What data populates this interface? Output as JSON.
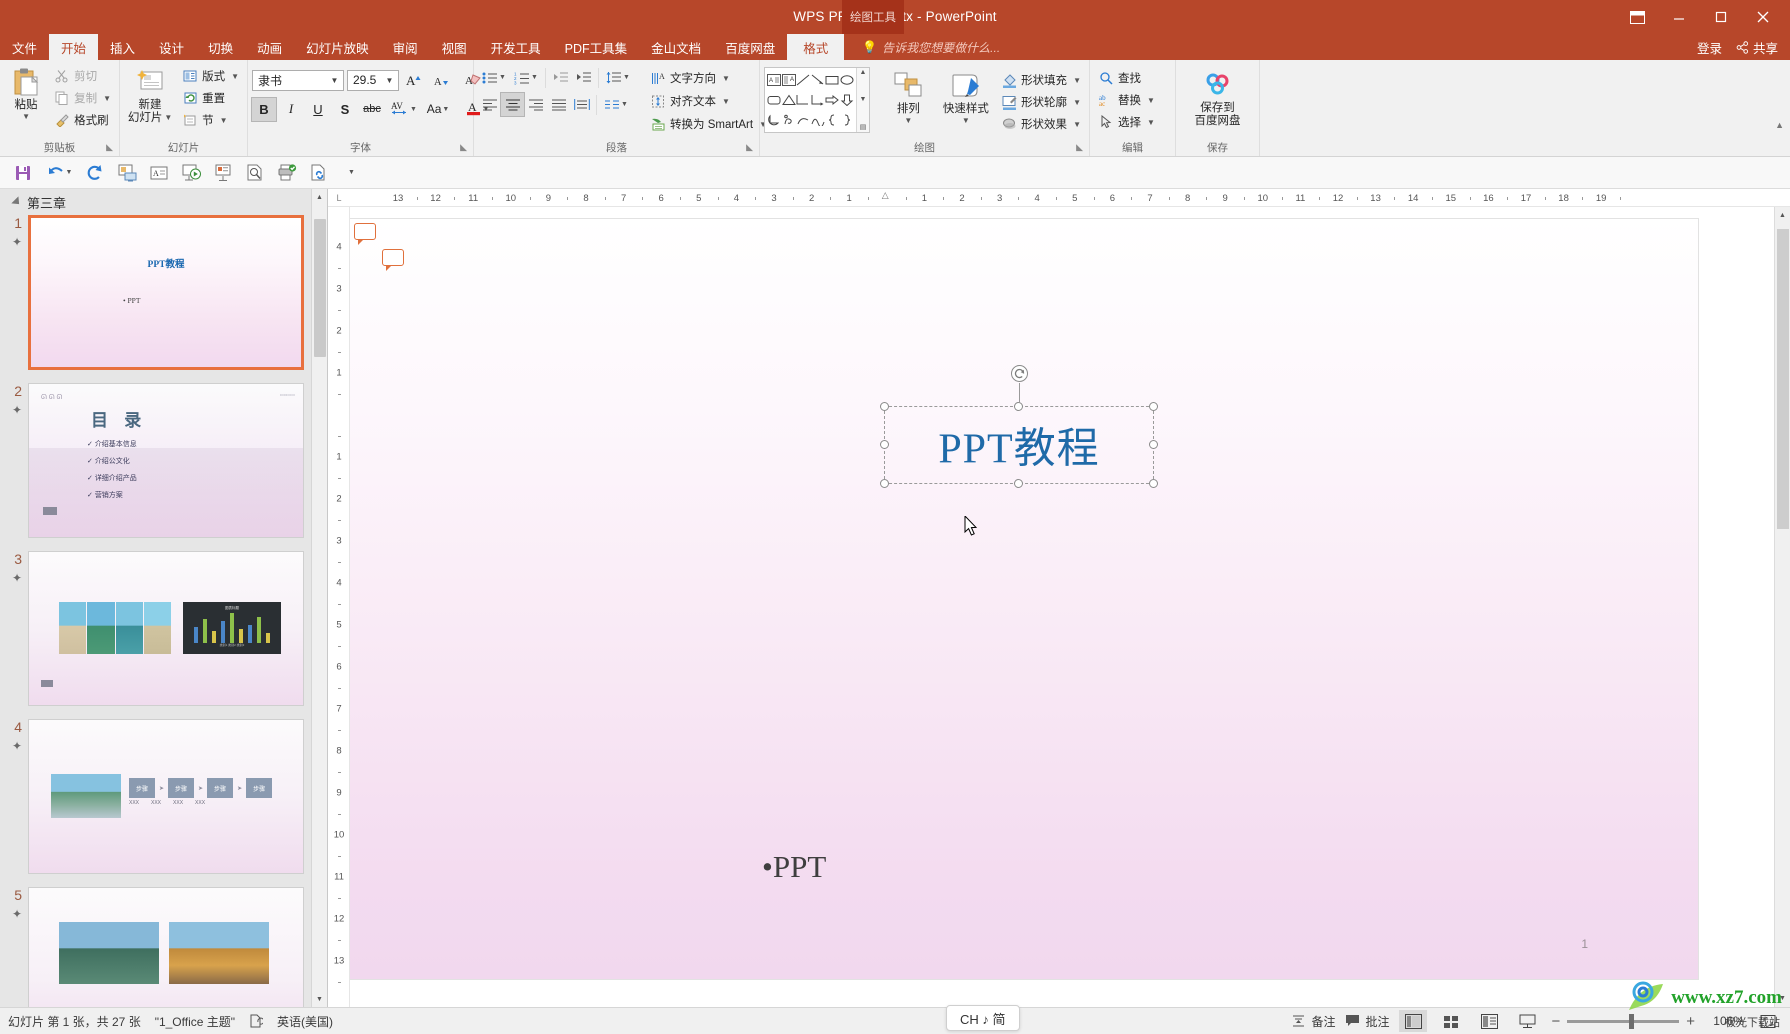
{
  "window": {
    "title": "WPS PPT教程.pptx - PowerPoint",
    "contextual_tool_label": "绘图工具",
    "restore_label": "▣",
    "minimize_label": "–",
    "maximize_label": "□",
    "close_label": "✕"
  },
  "tabs": [
    {
      "label": "文件",
      "active": false
    },
    {
      "label": "开始",
      "active": true
    },
    {
      "label": "插入",
      "active": false
    },
    {
      "label": "设计",
      "active": false
    },
    {
      "label": "切换",
      "active": false
    },
    {
      "label": "动画",
      "active": false
    },
    {
      "label": "幻灯片放映",
      "active": false
    },
    {
      "label": "审阅",
      "active": false
    },
    {
      "label": "视图",
      "active": false
    },
    {
      "label": "开发工具",
      "active": false
    },
    {
      "label": "PDF工具集",
      "active": false
    },
    {
      "label": "金山文档",
      "active": false
    },
    {
      "label": "百度网盘",
      "active": false
    }
  ],
  "contextual_tab": {
    "label": "格式"
  },
  "tellme": {
    "placeholder": "告诉我您想要做什么..."
  },
  "account": {
    "signin": "登录",
    "share": "共享"
  },
  "ribbon": {
    "clipboard": {
      "group_label": "剪贴板",
      "paste": "粘贴",
      "cut": "剪切",
      "copy": "复制",
      "format_painter": "格式刷"
    },
    "slides": {
      "group_label": "幻灯片",
      "new_slide_line1": "新建",
      "new_slide_line2": "幻灯片",
      "layout": "版式",
      "reset": "重置",
      "section": "节"
    },
    "font": {
      "group_label": "字体",
      "font_name": "隶书",
      "font_size": "29.5",
      "grow": "A",
      "shrink": "A",
      "clear_format": "清除所有格式",
      "bold": "B",
      "italic": "I",
      "underline": "U",
      "shadow": "S",
      "strikethrough": "abc",
      "char_spacing": "AV",
      "change_case": "Aa",
      "font_color": "A"
    },
    "paragraph": {
      "group_label": "段落",
      "bullets": "项目符号",
      "numbering": "编号",
      "decrease_indent": "减少缩进量",
      "increase_indent": "增加缩进量",
      "line_spacing": "行距",
      "align_left": "左对齐",
      "align_center": "居中",
      "align_right": "右对齐",
      "justify": "两端对齐",
      "distribute": "分散对齐",
      "columns": "分栏",
      "text_direction": "文字方向",
      "align_text": "对齐文本",
      "smartart": "转换为 SmartArt"
    },
    "drawing": {
      "group_label": "绘图",
      "arrange": "排列",
      "quick_styles": "快速样式",
      "shape_fill": "形状填充",
      "shape_outline": "形状轮廓",
      "shape_effects": "形状效果"
    },
    "editing": {
      "group_label": "编辑",
      "find": "查找",
      "replace": "替换",
      "select": "选择"
    },
    "save": {
      "group_label": "保存",
      "baidu_line1": "保存到",
      "baidu_line2": "百度网盘"
    }
  },
  "qat": {
    "save": "保存",
    "undo": "撤消",
    "redo": "恢复",
    "start_presentation": "从头开始",
    "text_box": "文本框",
    "present_online": "联机演示",
    "current_slide": "从当前幻灯片开始",
    "preview": "打印预览",
    "print": "快速打印",
    "hyperlink": "超链接"
  },
  "slide_panel": {
    "section_name": "第三章",
    "slides": [
      {
        "num": "1",
        "selected": true,
        "title": "PPT教程",
        "body": "PPT"
      },
      {
        "num": "2",
        "selected": false,
        "title": "目 录",
        "items": [
          "介绍基本信息",
          "介绍公文化",
          "详细介绍产品",
          "营销方案"
        ]
      },
      {
        "num": "3",
        "selected": false,
        "title": ""
      },
      {
        "num": "4",
        "selected": false,
        "title": "",
        "steps": [
          "步骤",
          "步骤",
          "步骤",
          "步骤"
        ],
        "captions": [
          "XXX",
          "XXX",
          "XXX",
          "XXX"
        ]
      },
      {
        "num": "5",
        "selected": false,
        "title": ""
      }
    ]
  },
  "ruler": {
    "h_ticks": [
      "13",
      "12",
      "11",
      "10",
      "9",
      "8",
      "7",
      "6",
      "5",
      "4",
      "3",
      "2",
      "1",
      "",
      "1",
      "2",
      "3",
      "4",
      "5",
      "6",
      "7",
      "8",
      "9",
      "10",
      "11",
      "12",
      "13",
      "14",
      "15",
      "16",
      "17",
      "18",
      "19"
    ],
    "v_ticks": [
      "4",
      "3",
      "2",
      "1",
      "",
      "1",
      "2",
      "3",
      "4",
      "5",
      "6",
      "7",
      "8",
      "9",
      "10",
      "11",
      "12",
      "13"
    ]
  },
  "slide_canvas": {
    "title_text": "PPT教程",
    "body_text": "•PPT",
    "page_number": "1",
    "comment_marker_count": 2
  },
  "status_bar": {
    "slide_info": "幻灯片 第 1 张，共 27 张",
    "theme": "\"1_Office 主题\"",
    "language": "英语(美国)",
    "notes": "备注",
    "comments": "批注",
    "zoom_percent": "106%",
    "ime": "CH ♪ 简",
    "view_normal": "普通视图",
    "view_sorter": "幻灯片浏览",
    "view_reading": "阅读视图",
    "view_show": "幻灯片放映",
    "fit_window": "适应窗口"
  },
  "watermark": {
    "text": "www.xz7.com",
    "sub": "极光下载站"
  },
  "colors": {
    "brand": "#b7472a",
    "brand_dark": "#a5321a",
    "title_blue": "#1f6aa8",
    "select_orange": "#e8703e",
    "accent_blue": "#2b7cd3"
  }
}
